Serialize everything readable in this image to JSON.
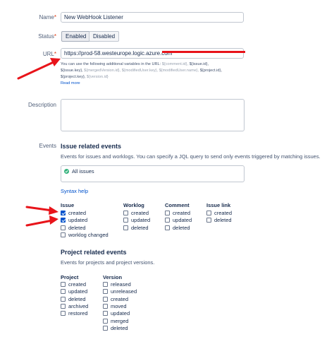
{
  "form": {
    "name_label": "Name",
    "name_value": "New WebHook Listener",
    "status_label": "Status",
    "status_enabled": "Enabled",
    "status_disabled": "Disabled",
    "url_label": "URL",
    "url_value": "https://prod-58.westeurope.logic.azure.com",
    "url_help_line1_a": "You can use the following additional variables in the URL: ",
    "url_help_line1_b": "${comment.id}, ",
    "url_help_line1_c": "${issue.id},",
    "url_help_line2_a": "${issue.key}, ",
    "url_help_line2_b": "${mergedVersion.id}, ${modifiedUser.key}, ${modifiedUser.name}, ",
    "url_help_line2_c": "${project.id},",
    "url_help_line3_a": "${project.key}, ",
    "url_help_line3_b": "${version.id}",
    "read_more": "Read more",
    "description_label": "Description",
    "description_value": "",
    "events_label": "Events"
  },
  "issue_events": {
    "title": "Issue related events",
    "description": "Events for issues and worklogs. You can specify a JQL query to send only events triggered by matching issues.",
    "jql_value": "All issues",
    "syntax_help": "Syntax help",
    "columns": [
      {
        "heading": "Issue",
        "items": [
          {
            "label": "created",
            "checked": true
          },
          {
            "label": "updated",
            "checked": true
          },
          {
            "label": "deleted",
            "checked": false
          },
          {
            "label": "worklog changed",
            "checked": false
          }
        ]
      },
      {
        "heading": "Worklog",
        "items": [
          {
            "label": "created",
            "checked": false
          },
          {
            "label": "updated",
            "checked": false
          },
          {
            "label": "deleted",
            "checked": false
          }
        ]
      },
      {
        "heading": "Comment",
        "items": [
          {
            "label": "created",
            "checked": false
          },
          {
            "label": "updated",
            "checked": false
          },
          {
            "label": "deleted",
            "checked": false
          }
        ]
      },
      {
        "heading": "Issue link",
        "items": [
          {
            "label": "created",
            "checked": false
          },
          {
            "label": "deleted",
            "checked": false
          }
        ]
      }
    ]
  },
  "project_events": {
    "title": "Project related events",
    "description": "Events for projects and project versions.",
    "columns": [
      {
        "heading": "Project",
        "items": [
          {
            "label": "created",
            "checked": false
          },
          {
            "label": "updated",
            "checked": false
          },
          {
            "label": "deleted",
            "checked": false
          },
          {
            "label": "archived",
            "checked": false
          },
          {
            "label": "restored",
            "checked": false
          }
        ]
      },
      {
        "heading": "Version",
        "items": [
          {
            "label": "released",
            "checked": false
          },
          {
            "label": "unreleased",
            "checked": false
          },
          {
            "label": "created",
            "checked": false
          },
          {
            "label": "moved",
            "checked": false
          },
          {
            "label": "updated",
            "checked": false
          },
          {
            "label": "merged",
            "checked": false
          },
          {
            "label": "deleted",
            "checked": false
          }
        ]
      }
    ]
  },
  "colors": {
    "accent": "#0052cc",
    "annotation_red": "#e8141a",
    "success": "#36b37e"
  }
}
